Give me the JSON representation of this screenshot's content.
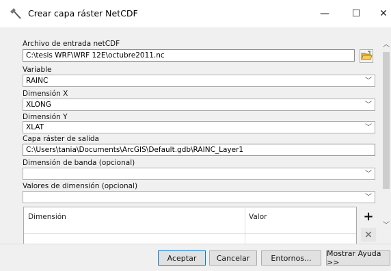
{
  "window": {
    "title": "Crear capa ráster NetCDF",
    "minimize_glyph": "—",
    "maximize_glyph": "☐",
    "close_glyph": "✕"
  },
  "icons": {
    "app": "hammer-icon",
    "folder": "open-folder-icon",
    "add": "plus-icon",
    "remove": "x-icon",
    "chevron": "chevron-down-icon"
  },
  "form": {
    "input_file": {
      "label": "Archivo de entrada netCDF",
      "value": "C:\\tesis WRF\\WRF 12E\\octubre2011.nc"
    },
    "variable": {
      "label": "Variable",
      "value": "RAINC"
    },
    "dim_x": {
      "label": "Dimensión X",
      "value": "XLONG"
    },
    "dim_y": {
      "label": "Dimensión Y",
      "value": "XLAT"
    },
    "output": {
      "label": "Capa ráster de salida",
      "value": "C:\\Users\\tania\\Documents\\ArcGIS\\Default.gdb\\RAINC_Layer1"
    },
    "band_dim": {
      "label": "Dimensión de banda (opcional)",
      "value": ""
    },
    "dim_values": {
      "label": "Valores de dimensión (opcional)",
      "value": ""
    }
  },
  "table": {
    "columns": [
      "Dimensión",
      "Valor"
    ],
    "add_glyph": "+",
    "remove_glyph": "×"
  },
  "buttons": {
    "ok": "Aceptar",
    "cancel": "Cancelar",
    "env": "Entornos...",
    "help": "Mostrar Ayuda >>"
  },
  "colors": {
    "accent": "#0078d7",
    "folder": "#e8b33c"
  }
}
